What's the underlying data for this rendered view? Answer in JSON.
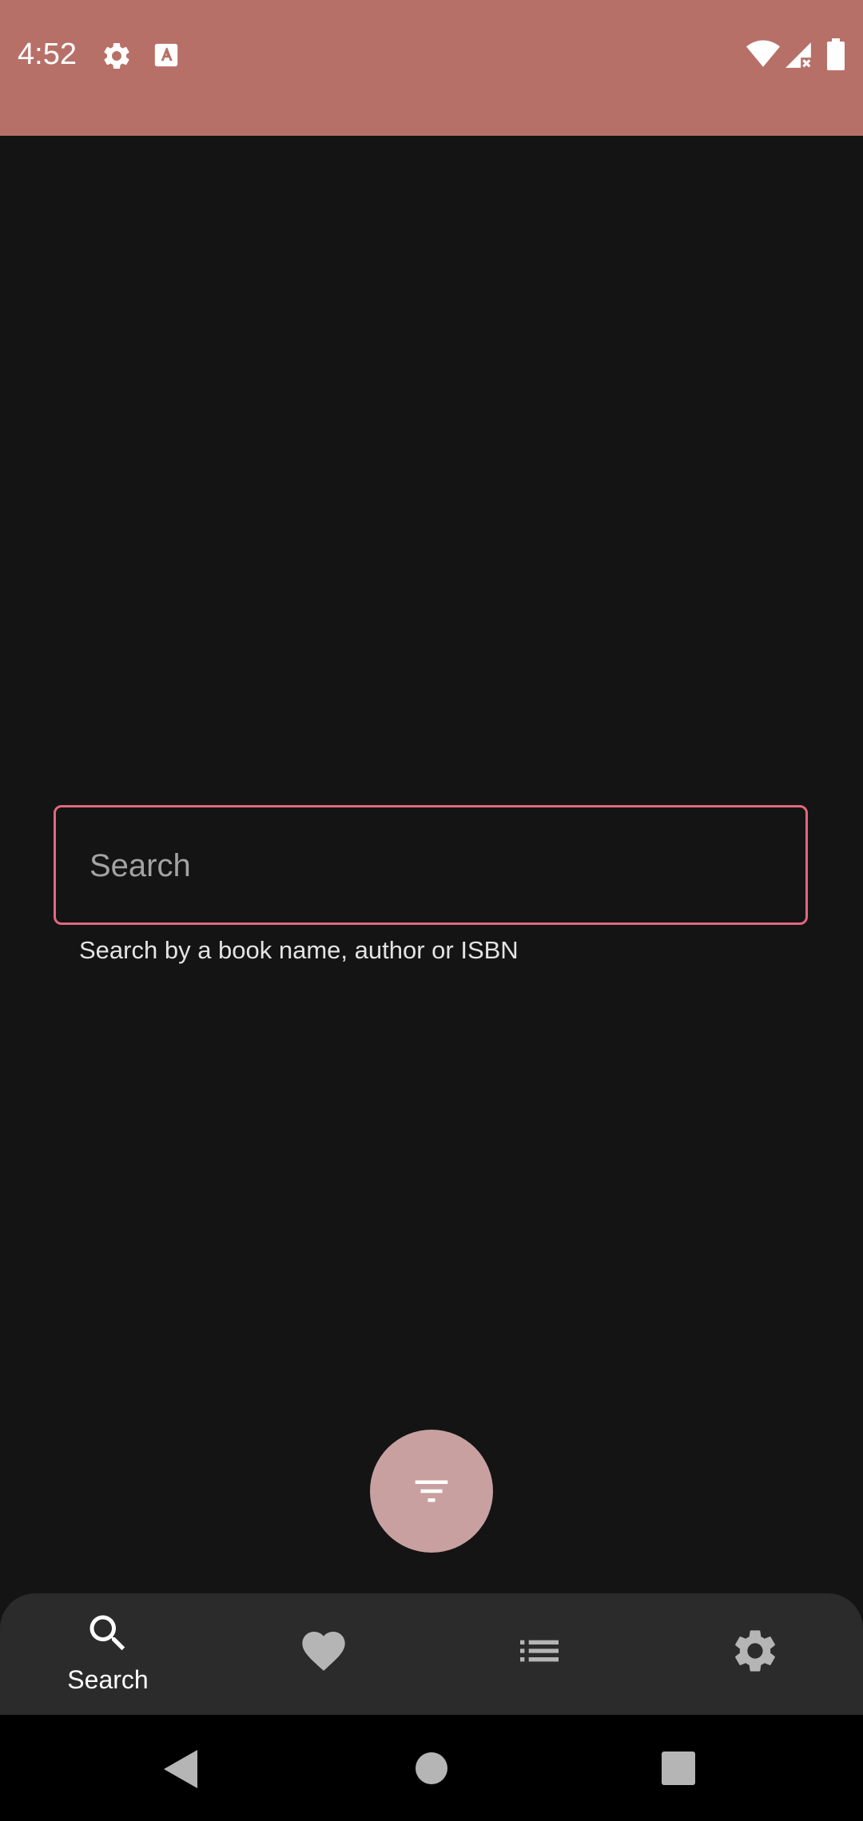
{
  "status_bar": {
    "time": "4:52",
    "icons": [
      "settings-icon",
      "text-a-icon",
      "wifi-icon",
      "signal-icon",
      "battery-icon"
    ],
    "background": "#b77068"
  },
  "search": {
    "placeholder": "Search",
    "value": "",
    "helper": "Search by a book name, author or ISBN",
    "border_color": "#e2687e"
  },
  "fab": {
    "icon": "filter-icon",
    "color": "#c9a0a0"
  },
  "bottom_nav": {
    "items": [
      {
        "label": "Search",
        "icon": "search-icon",
        "selected": true
      },
      {
        "label": "",
        "icon": "heart-icon",
        "selected": false
      },
      {
        "label": "",
        "icon": "list-icon",
        "selected": false
      },
      {
        "label": "",
        "icon": "gear-icon",
        "selected": false
      }
    ]
  },
  "system_nav": {
    "buttons": [
      "back",
      "home",
      "recents"
    ]
  }
}
